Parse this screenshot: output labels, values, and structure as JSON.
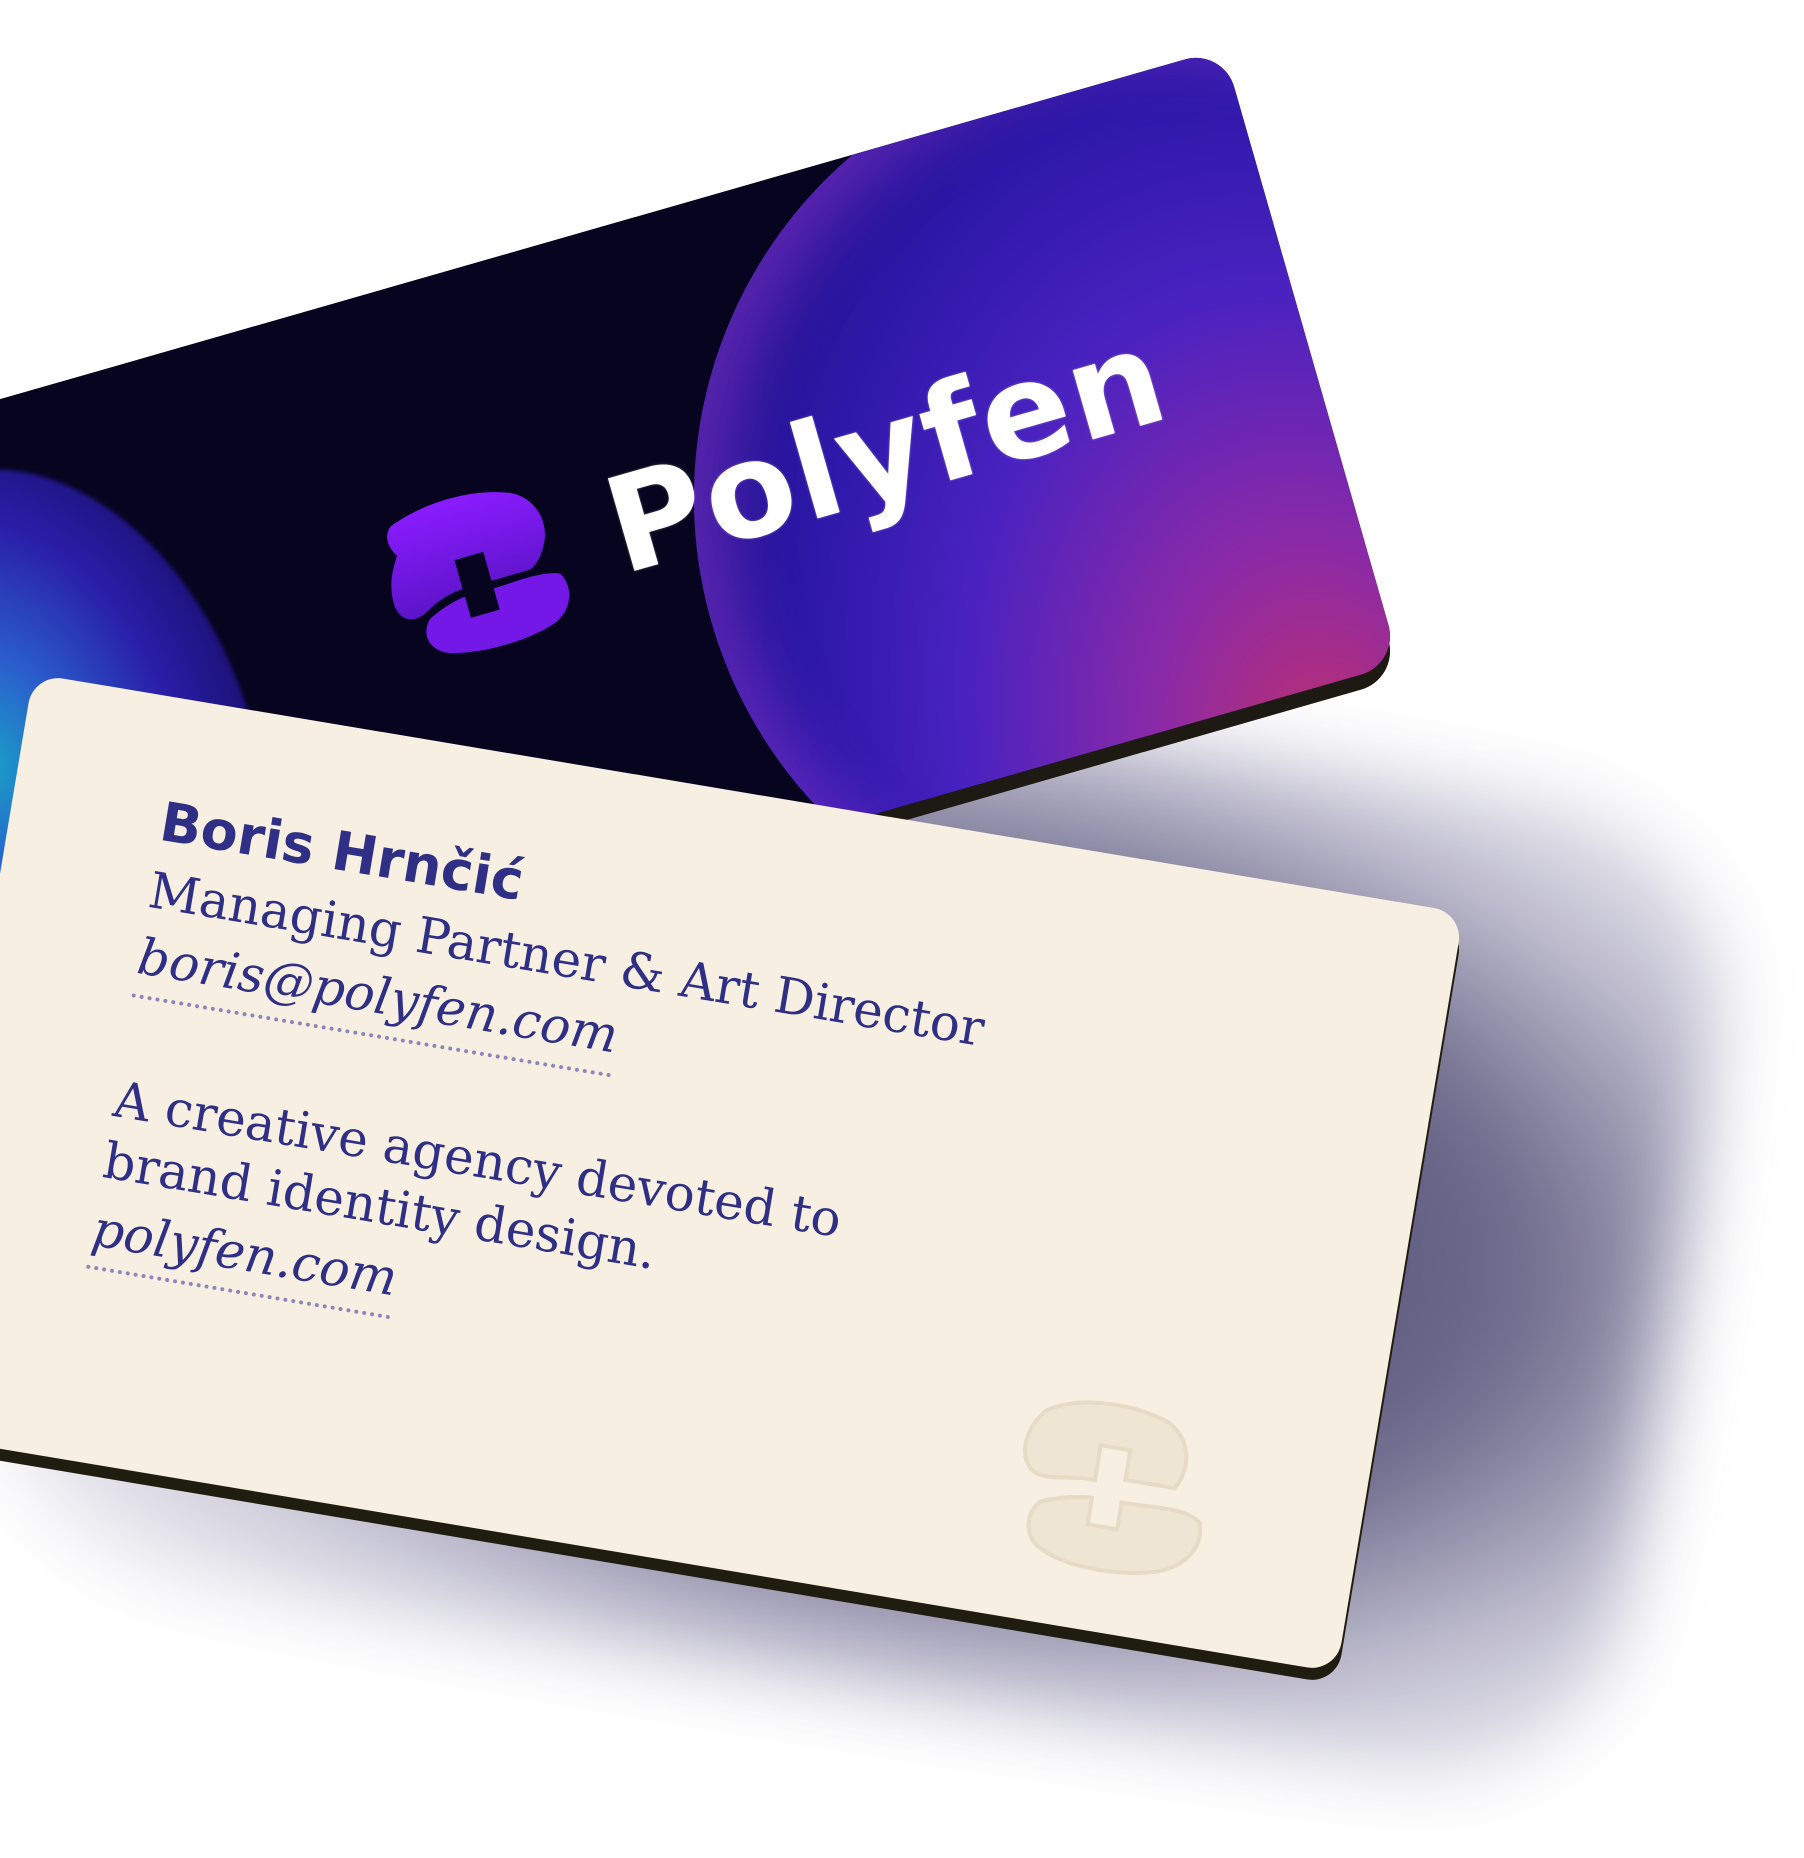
{
  "back_card": {
    "brand_name": "Polyfen",
    "logo_icon": "polyfen-logo-icon",
    "colors": {
      "background": "#06041f",
      "accent_purple": "#7a18f0",
      "sphere_blue": "#2a1ea8",
      "sphere_magenta": "#c0306a",
      "edge": "#1c1a12"
    }
  },
  "front_card": {
    "name": "Boris Hrnčić",
    "title": "Managing Partner & Art Director",
    "email": "boris@polyfen.com",
    "tagline": "A creative agency devoted to brand identity design.",
    "website": "polyfen.com",
    "watermark_icon": "polyfen-emboss-icon",
    "colors": {
      "background": "#f7efe2",
      "text": "#2e2f85",
      "underline": "#8d86b8"
    }
  }
}
